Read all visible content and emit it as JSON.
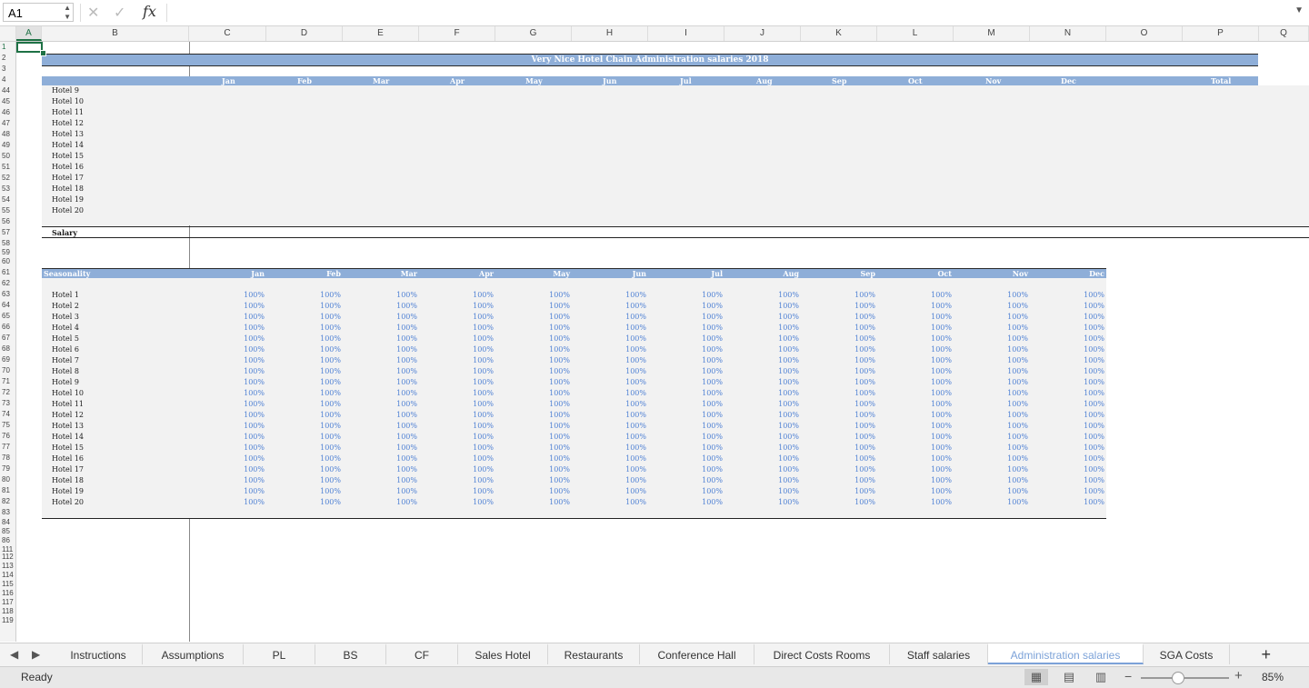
{
  "formula_bar": {
    "cell_ref": "A1",
    "fx": "fx",
    "formula": ""
  },
  "columns": [
    "A",
    "B",
    "C",
    "D",
    "E",
    "F",
    "G",
    "H",
    "I",
    "J",
    "K",
    "L",
    "M",
    "N",
    "O",
    "P",
    "Q"
  ],
  "rows": [
    "1",
    "2",
    "3",
    "4",
    "44",
    "45",
    "46",
    "47",
    "48",
    "49",
    "50",
    "51",
    "52",
    "53",
    "54",
    "55",
    "56",
    "57",
    "58",
    "59",
    "60",
    "61",
    "62",
    "63",
    "64",
    "65",
    "66",
    "67",
    "68",
    "69",
    "70",
    "71",
    "72",
    "73",
    "74",
    "75",
    "76",
    "77",
    "78",
    "79",
    "80",
    "81",
    "82",
    "83",
    "84",
    "85",
    "86",
    "111",
    "112",
    "113",
    "114",
    "115",
    "116",
    "117",
    "118",
    "119"
  ],
  "sheet": {
    "title": "Very Nice Hotel Chain Administration salaries 2018",
    "months": [
      "Jan",
      "Feb",
      "Mar",
      "Apr",
      "May",
      "Jun",
      "Jul",
      "Aug",
      "Sep",
      "Oct",
      "Nov",
      "Dec"
    ],
    "total_label": "Total",
    "upper_hotels": [
      "Hotel 9",
      "Hotel 10",
      "Hotel 11",
      "Hotel 12",
      "Hotel 13",
      "Hotel 14",
      "Hotel 15",
      "Hotel 16",
      "Hotel 17",
      "Hotel 18",
      "Hotel 19",
      "Hotel 20"
    ],
    "salary_label": "Salary",
    "seasonality_label": "Seasonality",
    "lower_hotels": [
      "Hotel 1",
      "Hotel 2",
      "Hotel 3",
      "Hotel 4",
      "Hotel 5",
      "Hotel 6",
      "Hotel 7",
      "Hotel 8",
      "Hotel 9",
      "Hotel 10",
      "Hotel 11",
      "Hotel 12",
      "Hotel 13",
      "Hotel 14",
      "Hotel 15",
      "Hotel 16",
      "Hotel 17",
      "Hotel 18",
      "Hotel 19",
      "Hotel 20"
    ],
    "seasonality_value": "100%"
  },
  "tabs": [
    "Instructions",
    "Assumptions",
    "PL",
    "BS",
    "CF",
    "Sales Hotel",
    "Restaurants",
    "Conference Hall",
    "Direct Costs Rooms",
    "Staff salaries",
    "Administration salaries",
    "SGA Costs"
  ],
  "active_tab": "Administration salaries",
  "status": {
    "ready": "Ready",
    "zoom": "85%"
  },
  "colors": {
    "header_blue": "#8eaed8",
    "pct_blue": "#4f81d4",
    "accent_green": "#1e7145"
  }
}
